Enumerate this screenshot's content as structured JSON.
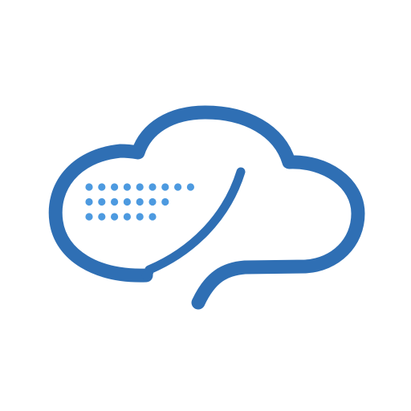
{
  "logo": {
    "name": "cloud-logo",
    "colors": {
      "outline": "#2f6fb4",
      "dots": "#4d9ae0",
      "background": "#ffffff"
    },
    "dot_rows": [
      {
        "count": 9
      },
      {
        "count": 7
      },
      {
        "count": 6
      }
    ]
  }
}
